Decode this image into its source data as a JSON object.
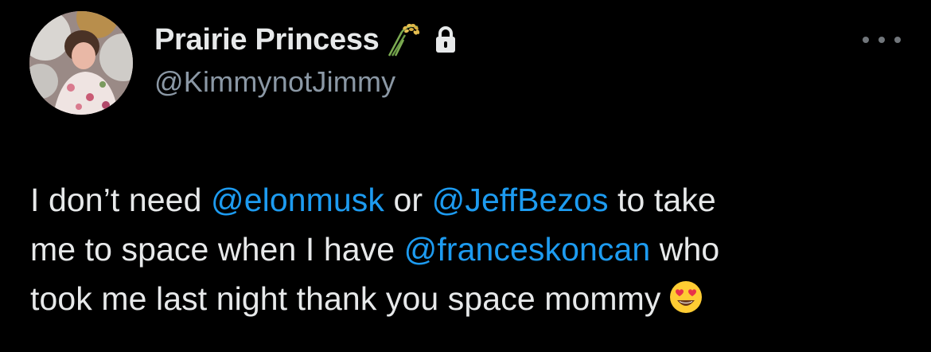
{
  "author": {
    "display_name": "Prairie Princess",
    "handle": "@KimmynotJimmy",
    "badge_icons": [
      "rice-sheaf-icon",
      "lock-icon"
    ],
    "avatar_icon": "profile-photo"
  },
  "menu": {
    "more_icon": "ellipsis-icon"
  },
  "tweet": {
    "line1": {
      "t1": "I don’t need ",
      "m1": "@elonmusk",
      "t2": " or ",
      "m2": "@JeffBezos",
      "t3": " to take"
    },
    "line2": {
      "t1": "me to space when I have ",
      "m1": "@franceskoncan",
      "t2": " who"
    },
    "line3": {
      "t1": "took me last night thank you space mommy",
      "emoji": "heart-eyes-emoji"
    }
  },
  "colors": {
    "background": "#000000",
    "text": "#e7e9ea",
    "secondary": "#8b98a5",
    "mention": "#1d9bf0"
  }
}
